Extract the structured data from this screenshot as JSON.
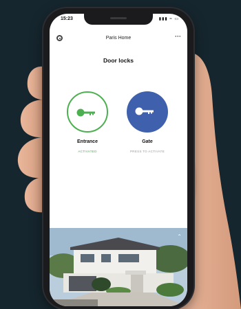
{
  "status_bar": {
    "time": "15:23",
    "icons": "▮▮▮ ≈ ▭"
  },
  "header": {
    "home_name": "Paris Home",
    "more_label": "···"
  },
  "page": {
    "title": "Door locks"
  },
  "locks": [
    {
      "name": "Entrance",
      "status": "ACTIVATED",
      "state_color": "#4caf50"
    },
    {
      "name": "Gate",
      "status": "PRESS TO ACTIVATE",
      "state_color": "#3f60ad"
    }
  ],
  "icons": {
    "settings": "gear-icon",
    "more": "more-icon",
    "key": "key-icon",
    "expand": "chevron-up-icon"
  },
  "colors": {
    "background": "#16262e",
    "activated": "#4caf50",
    "inactive_button": "#3f60ad",
    "status_inactive_text": "#9a9a9a"
  }
}
